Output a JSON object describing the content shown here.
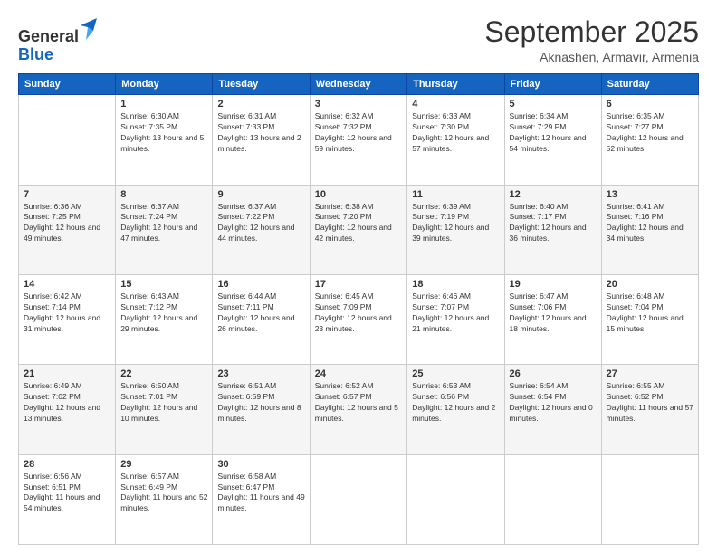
{
  "logo": {
    "general": "General",
    "blue": "Blue"
  },
  "header": {
    "month": "September 2025",
    "location": "Aknashen, Armavir, Armenia"
  },
  "weekdays": [
    "Sunday",
    "Monday",
    "Tuesday",
    "Wednesday",
    "Thursday",
    "Friday",
    "Saturday"
  ],
  "weeks": [
    [
      null,
      {
        "day": 1,
        "sunrise": "6:30 AM",
        "sunset": "7:35 PM",
        "daylight": "13 hours and 5 minutes."
      },
      {
        "day": 2,
        "sunrise": "6:31 AM",
        "sunset": "7:33 PM",
        "daylight": "13 hours and 2 minutes."
      },
      {
        "day": 3,
        "sunrise": "6:32 AM",
        "sunset": "7:32 PM",
        "daylight": "12 hours and 59 minutes."
      },
      {
        "day": 4,
        "sunrise": "6:33 AM",
        "sunset": "7:30 PM",
        "daylight": "12 hours and 57 minutes."
      },
      {
        "day": 5,
        "sunrise": "6:34 AM",
        "sunset": "7:29 PM",
        "daylight": "12 hours and 54 minutes."
      },
      {
        "day": 6,
        "sunrise": "6:35 AM",
        "sunset": "7:27 PM",
        "daylight": "12 hours and 52 minutes."
      }
    ],
    [
      {
        "day": 7,
        "sunrise": "6:36 AM",
        "sunset": "7:25 PM",
        "daylight": "12 hours and 49 minutes."
      },
      {
        "day": 8,
        "sunrise": "6:37 AM",
        "sunset": "7:24 PM",
        "daylight": "12 hours and 47 minutes."
      },
      {
        "day": 9,
        "sunrise": "6:37 AM",
        "sunset": "7:22 PM",
        "daylight": "12 hours and 44 minutes."
      },
      {
        "day": 10,
        "sunrise": "6:38 AM",
        "sunset": "7:20 PM",
        "daylight": "12 hours and 42 minutes."
      },
      {
        "day": 11,
        "sunrise": "6:39 AM",
        "sunset": "7:19 PM",
        "daylight": "12 hours and 39 minutes."
      },
      {
        "day": 12,
        "sunrise": "6:40 AM",
        "sunset": "7:17 PM",
        "daylight": "12 hours and 36 minutes."
      },
      {
        "day": 13,
        "sunrise": "6:41 AM",
        "sunset": "7:16 PM",
        "daylight": "12 hours and 34 minutes."
      }
    ],
    [
      {
        "day": 14,
        "sunrise": "6:42 AM",
        "sunset": "7:14 PM",
        "daylight": "12 hours and 31 minutes."
      },
      {
        "day": 15,
        "sunrise": "6:43 AM",
        "sunset": "7:12 PM",
        "daylight": "12 hours and 29 minutes."
      },
      {
        "day": 16,
        "sunrise": "6:44 AM",
        "sunset": "7:11 PM",
        "daylight": "12 hours and 26 minutes."
      },
      {
        "day": 17,
        "sunrise": "6:45 AM",
        "sunset": "7:09 PM",
        "daylight": "12 hours and 23 minutes."
      },
      {
        "day": 18,
        "sunrise": "6:46 AM",
        "sunset": "7:07 PM",
        "daylight": "12 hours and 21 minutes."
      },
      {
        "day": 19,
        "sunrise": "6:47 AM",
        "sunset": "7:06 PM",
        "daylight": "12 hours and 18 minutes."
      },
      {
        "day": 20,
        "sunrise": "6:48 AM",
        "sunset": "7:04 PM",
        "daylight": "12 hours and 15 minutes."
      }
    ],
    [
      {
        "day": 21,
        "sunrise": "6:49 AM",
        "sunset": "7:02 PM",
        "daylight": "12 hours and 13 minutes."
      },
      {
        "day": 22,
        "sunrise": "6:50 AM",
        "sunset": "7:01 PM",
        "daylight": "12 hours and 10 minutes."
      },
      {
        "day": 23,
        "sunrise": "6:51 AM",
        "sunset": "6:59 PM",
        "daylight": "12 hours and 8 minutes."
      },
      {
        "day": 24,
        "sunrise": "6:52 AM",
        "sunset": "6:57 PM",
        "daylight": "12 hours and 5 minutes."
      },
      {
        "day": 25,
        "sunrise": "6:53 AM",
        "sunset": "6:56 PM",
        "daylight": "12 hours and 2 minutes."
      },
      {
        "day": 26,
        "sunrise": "6:54 AM",
        "sunset": "6:54 PM",
        "daylight": "12 hours and 0 minutes."
      },
      {
        "day": 27,
        "sunrise": "6:55 AM",
        "sunset": "6:52 PM",
        "daylight": "11 hours and 57 minutes."
      }
    ],
    [
      {
        "day": 28,
        "sunrise": "6:56 AM",
        "sunset": "6:51 PM",
        "daylight": "11 hours and 54 minutes."
      },
      {
        "day": 29,
        "sunrise": "6:57 AM",
        "sunset": "6:49 PM",
        "daylight": "11 hours and 52 minutes."
      },
      {
        "day": 30,
        "sunrise": "6:58 AM",
        "sunset": "6:47 PM",
        "daylight": "11 hours and 49 minutes."
      },
      null,
      null,
      null,
      null
    ]
  ]
}
